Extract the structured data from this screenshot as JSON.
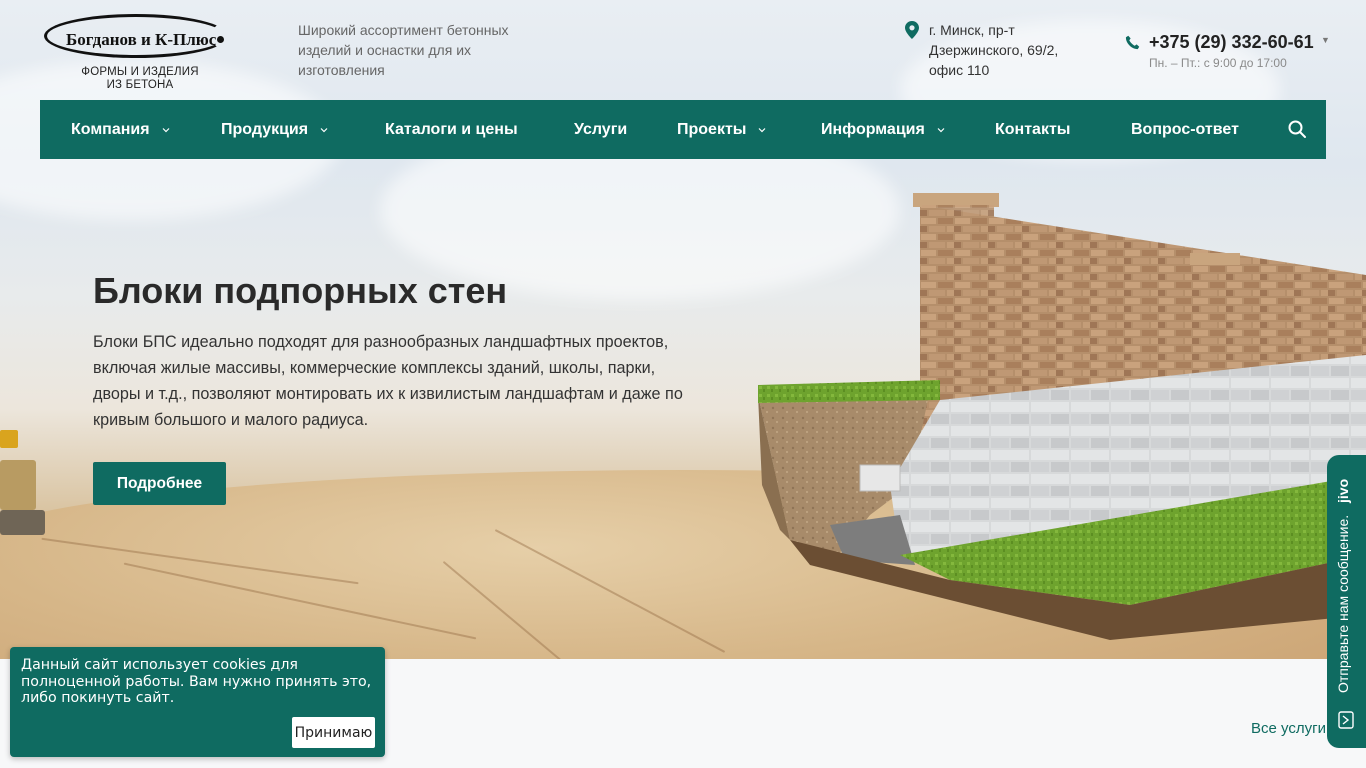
{
  "header": {
    "logo": {
      "name": "Богданов и К-Плюс",
      "sub_line1": "ФОРМЫ И ИЗДЕЛИЯ",
      "sub_line2": "ИЗ БЕТОНА"
    },
    "tagline": "Широкий ассортимент бетонных изделий и оснастки для их изготовления",
    "address": {
      "line1": "г. Минск, пр-т",
      "line2": "Дзержинского, 69/2,",
      "line3": "офис 110",
      "icon": "map-pin-icon"
    },
    "phone": {
      "number": "+375 (29) 332-60-61",
      "hours": "Пн. – Пт.: с 9:00 до 17:00",
      "icon": "phone-icon"
    }
  },
  "nav": {
    "items": [
      {
        "label": "Компания",
        "dropdown": true
      },
      {
        "label": "Продукция",
        "dropdown": true
      },
      {
        "label": "Каталоги и цены",
        "dropdown": false
      },
      {
        "label": "Услуги",
        "dropdown": false
      },
      {
        "label": "Проекты",
        "dropdown": true
      },
      {
        "label": "Информация",
        "dropdown": true
      },
      {
        "label": "Контакты",
        "dropdown": false
      },
      {
        "label": "Вопрос-ответ",
        "dropdown": false
      }
    ],
    "search_icon": "search-icon"
  },
  "hero": {
    "title": "Блоки подпорных стен",
    "text": "Блоки БПС идеально подходят для разнообразных ландшафтных проектов, включая жилые массивы, коммерческие комплексы зданий, школы, парки, дворы и т.д., позволяют монтировать их к извилистым ландшафтам и даже по кривым большого и малого радиуса.",
    "button": "Подробнее"
  },
  "services": {
    "all_link": "Все услуги"
  },
  "cookie": {
    "text": "Данный сайт использует cookies для полноценной работы. Вам нужно принять это, либо покинуть сайт.",
    "accept": "Принимаю"
  },
  "jivo": {
    "label": "Отправьте нам сообщение.",
    "brand": "jivo"
  },
  "colors": {
    "accent": "#0f6b61",
    "text": "#222222",
    "muted": "#666666"
  }
}
